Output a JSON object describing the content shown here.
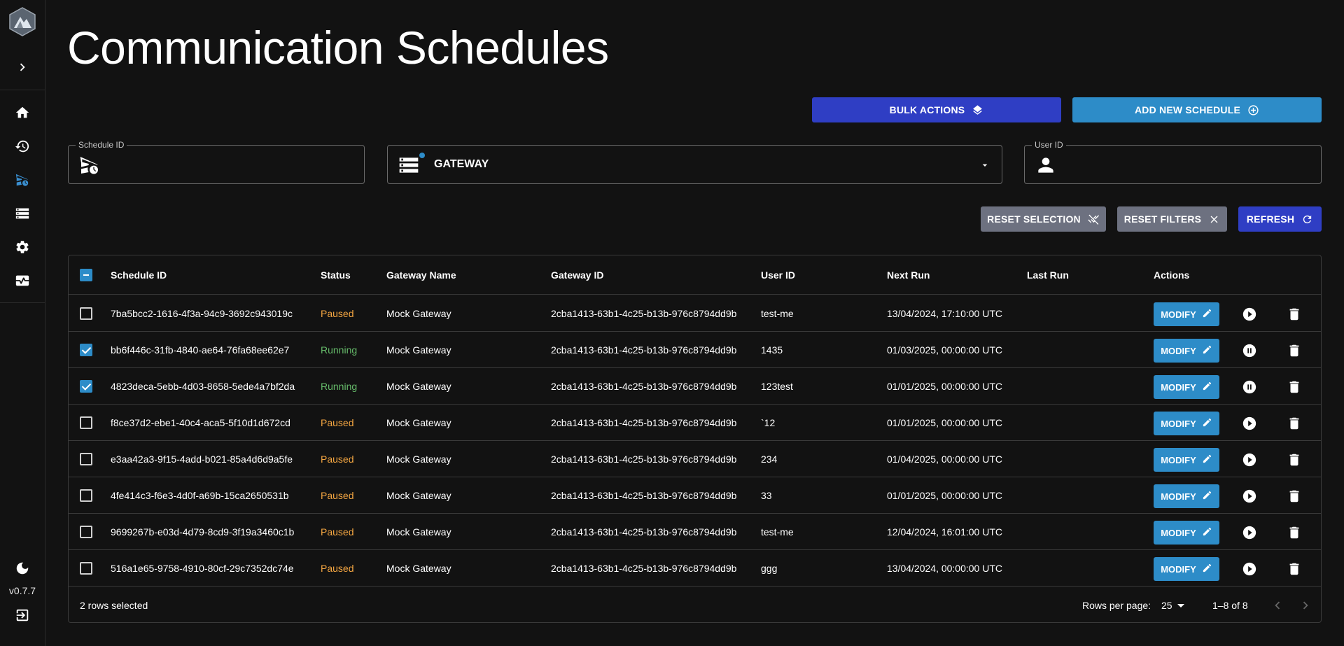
{
  "app": {
    "version": "v0.7.7"
  },
  "page": {
    "title": "Communication Schedules"
  },
  "actions": {
    "bulk_label": "BULK ACTIONS",
    "add_label": "ADD NEW SCHEDULE",
    "reset_selection_label": "RESET SELECTION",
    "reset_filters_label": "RESET FILTERS",
    "refresh_label": "REFRESH"
  },
  "filters": {
    "schedule_id": {
      "label": "Schedule ID",
      "value": ""
    },
    "gateway": {
      "value": "GATEWAY"
    },
    "user_id": {
      "label": "User ID",
      "value": ""
    }
  },
  "table": {
    "columns": {
      "schedule_id": "Schedule ID",
      "status": "Status",
      "gateway_name": "Gateway Name",
      "gateway_id": "Gateway ID",
      "user_id": "User ID",
      "next_run": "Next Run",
      "last_run": "Last Run",
      "actions": "Actions"
    },
    "modify_label": "MODIFY",
    "rows": [
      {
        "schedule_id": "7ba5bcc2-1616-4f3a-94c9-3692c943019c",
        "status": "Paused",
        "gateway_name": "Mock Gateway",
        "gateway_id": "2cba1413-63b1-4c25-b13b-976c8794dd9b",
        "user_id": "test-me",
        "next_run": "13/04/2024, 17:10:00 UTC",
        "last_run": "",
        "selected": false
      },
      {
        "schedule_id": "bb6f446c-31fb-4840-ae64-76fa68ee62e7",
        "status": "Running",
        "gateway_name": "Mock Gateway",
        "gateway_id": "2cba1413-63b1-4c25-b13b-976c8794dd9b",
        "user_id": "1435",
        "next_run": "01/03/2025, 00:00:00 UTC",
        "last_run": "",
        "selected": true
      },
      {
        "schedule_id": "4823deca-5ebb-4d03-8658-5ede4a7bf2da",
        "status": "Running",
        "gateway_name": "Mock Gateway",
        "gateway_id": "2cba1413-63b1-4c25-b13b-976c8794dd9b",
        "user_id": "123test",
        "next_run": "01/01/2025, 00:00:00 UTC",
        "last_run": "",
        "selected": true
      },
      {
        "schedule_id": "f8ce37d2-ebe1-40c4-aca5-5f10d1d672cd",
        "status": "Paused",
        "gateway_name": "Mock Gateway",
        "gateway_id": "2cba1413-63b1-4c25-b13b-976c8794dd9b",
        "user_id": "`12",
        "next_run": "01/01/2025, 00:00:00 UTC",
        "last_run": "",
        "selected": false
      },
      {
        "schedule_id": "e3aa42a3-9f15-4add-b021-85a4d6d9a5fe",
        "status": "Paused",
        "gateway_name": "Mock Gateway",
        "gateway_id": "2cba1413-63b1-4c25-b13b-976c8794dd9b",
        "user_id": "234",
        "next_run": "01/04/2025, 00:00:00 UTC",
        "last_run": "",
        "selected": false
      },
      {
        "schedule_id": "4fe414c3-f6e3-4d0f-a69b-15ca2650531b",
        "status": "Paused",
        "gateway_name": "Mock Gateway",
        "gateway_id": "2cba1413-63b1-4c25-b13b-976c8794dd9b",
        "user_id": "33",
        "next_run": "01/01/2025, 00:00:00 UTC",
        "last_run": "",
        "selected": false
      },
      {
        "schedule_id": "9699267b-e03d-4d79-8cd9-3f19a3460c1b",
        "status": "Paused",
        "gateway_name": "Mock Gateway",
        "gateway_id": "2cba1413-63b1-4c25-b13b-976c8794dd9b",
        "user_id": "test-me",
        "next_run": "12/04/2024, 16:01:00 UTC",
        "last_run": "",
        "selected": false
      },
      {
        "schedule_id": "516a1e65-9758-4910-80cf-29c7352dc74e",
        "status": "Paused",
        "gateway_name": "Mock Gateway",
        "gateway_id": "2cba1413-63b1-4c25-b13b-976c8794dd9b",
        "user_id": "ggg",
        "next_run": "13/04/2024, 00:00:00 UTC",
        "last_run": "",
        "selected": false
      }
    ],
    "footer": {
      "selected_text": "2 rows selected",
      "rows_per_page_label": "Rows per page:",
      "rows_per_page_value": "25",
      "range_text": "1–8 of 8"
    }
  },
  "colors": {
    "accent_blue": "#2d8cc8",
    "primary_indigo": "#2f3ec4",
    "gray_button": "#6d7180",
    "paused": "#f5a742",
    "running": "#66bb6a",
    "background": "#121212"
  },
  "icons": {
    "sidebar": [
      "home-icon",
      "history-icon",
      "schedule-send-icon",
      "storage-icon",
      "settings-icon",
      "monitor-heart-icon",
      "dark-mode-icon",
      "logout-icon"
    ]
  }
}
